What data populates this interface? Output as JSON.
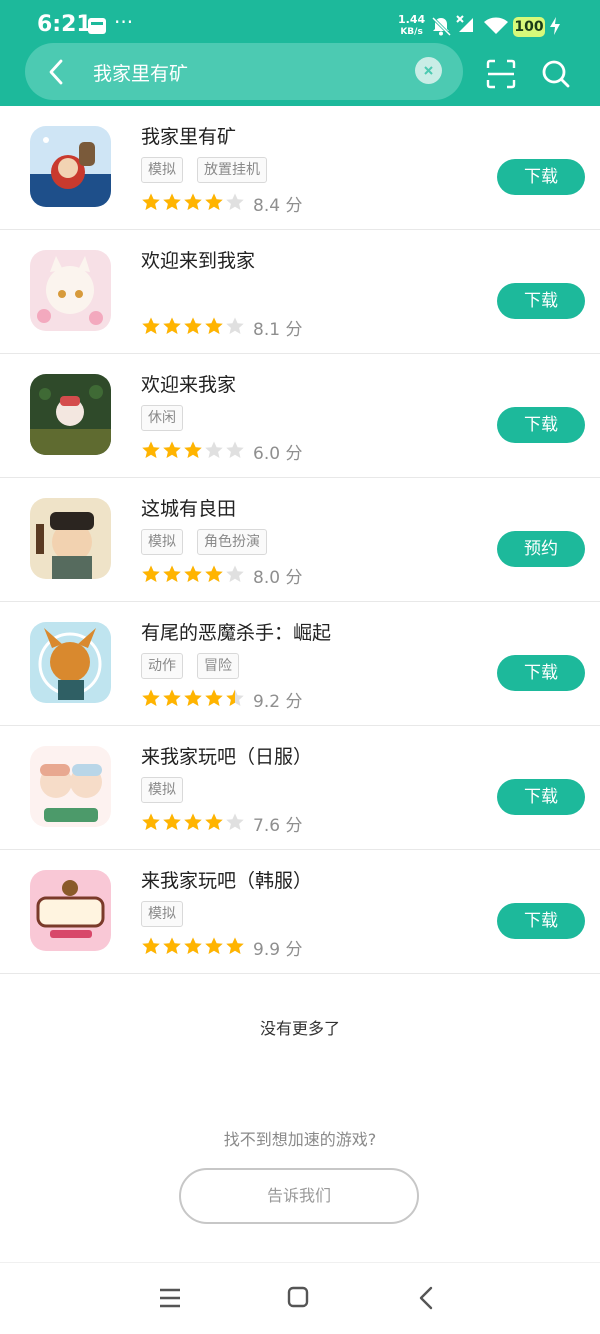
{
  "status_bar": {
    "time": "6:21",
    "net_speed_value": "1.44",
    "net_speed_unit": "KB/s",
    "battery": "100"
  },
  "search": {
    "query": "我家里有矿",
    "clear_icon": "clear-icon",
    "back_icon": "back-arrow-icon",
    "scan_icon": "scan-icon",
    "search_icon": "search-icon"
  },
  "colors": {
    "brand": "#1db99b",
    "star_on": "#ffb400",
    "star_off": "#e0e0e0"
  },
  "results": [
    {
      "title": "我家里有矿",
      "tags": [
        "模拟",
        "放置挂机"
      ],
      "stars": 4,
      "score": "8.4 分",
      "action": "下载"
    },
    {
      "title": "欢迎来到我家",
      "tags": [],
      "stars": 4,
      "score": "8.1 分",
      "action": "下载"
    },
    {
      "title": "欢迎来我家",
      "tags": [
        "休闲"
      ],
      "stars": 3,
      "score": "6.0 分",
      "action": "下载"
    },
    {
      "title": " 这城有良田",
      "tags": [
        "模拟",
        "角色扮演"
      ],
      "stars": 4,
      "score": "8.0 分",
      "action": "预约"
    },
    {
      "title": "有尾的恶魔杀手：崛起",
      "tags": [
        "动作",
        "冒险"
      ],
      "stars": 4.5,
      "score": "9.2 分",
      "action": "下载"
    },
    {
      "title": "来我家玩吧（日服）",
      "tags": [
        "模拟"
      ],
      "stars": 4,
      "score": "7.6 分",
      "action": "下载"
    },
    {
      "title": "来我家玩吧（韩服）",
      "tags": [
        "模拟"
      ],
      "stars": 5,
      "score": "9.9 分",
      "action": "下载"
    }
  ],
  "footer": {
    "no_more": "没有更多了",
    "prompt": "找不到想加速的游戏?",
    "tell_us": "告诉我们"
  },
  "nav": {
    "menu_icon": "menu-icon",
    "home_icon": "home-icon",
    "back_icon": "nav-back-icon"
  }
}
